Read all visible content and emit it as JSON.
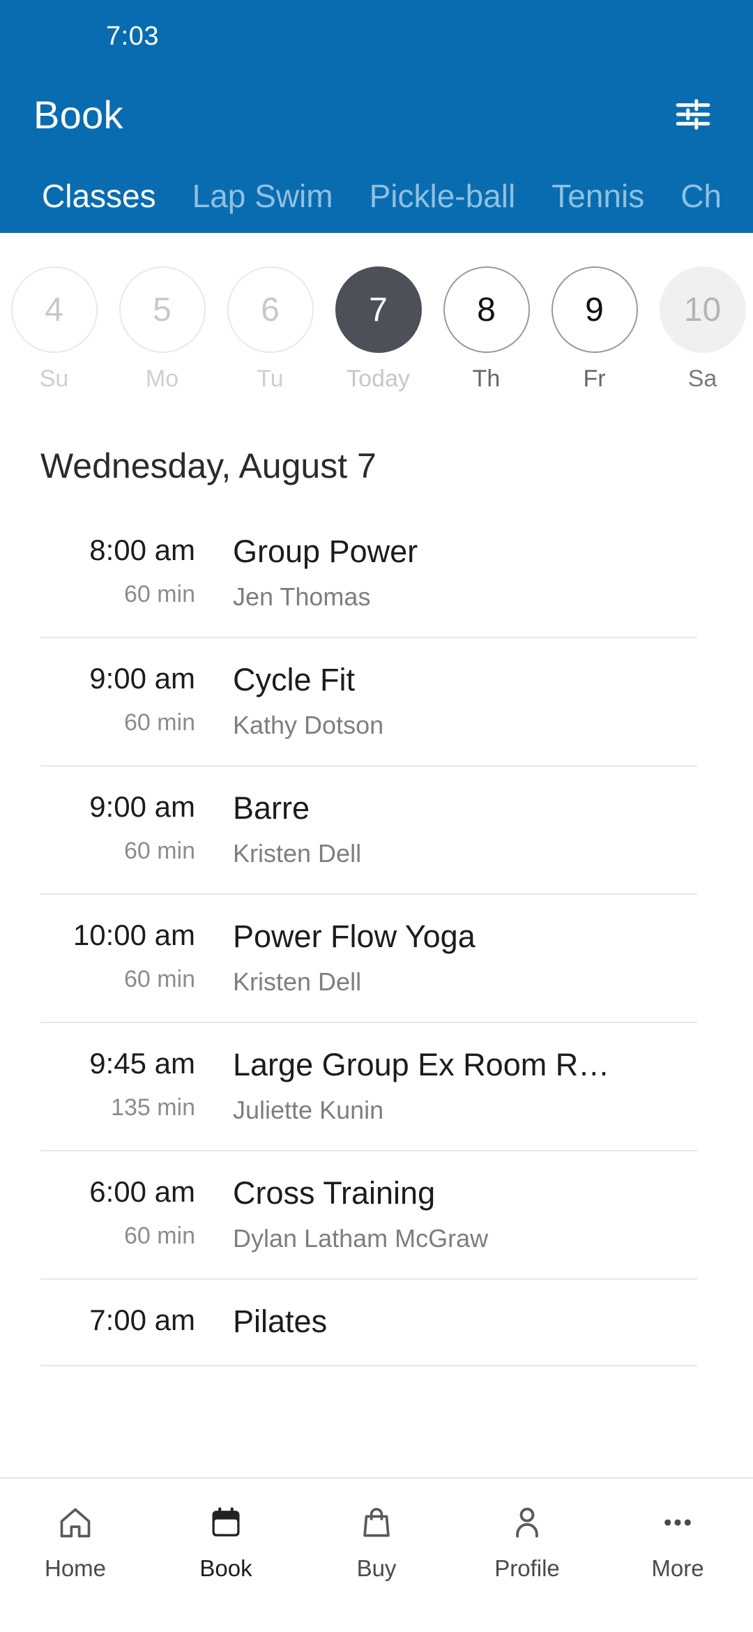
{
  "statusbar": {
    "time": "7:03"
  },
  "header": {
    "title": "Book",
    "filter_icon": "tune-sliders-icon",
    "background_color": "#0a6cb0",
    "tabs": [
      {
        "label": "Classes",
        "active": true
      },
      {
        "label": "Lap Swim",
        "active": false
      },
      {
        "label": "Pickle-ball",
        "active": false
      },
      {
        "label": "Tennis",
        "active": false
      },
      {
        "label": "Ch",
        "active": false
      }
    ]
  },
  "date_strip": [
    {
      "day": "4",
      "dow": "Su",
      "state": "disabled"
    },
    {
      "day": "5",
      "dow": "Mo",
      "state": "disabled"
    },
    {
      "day": "6",
      "dow": "Tu",
      "state": "disabled"
    },
    {
      "day": "7",
      "dow": "Today",
      "state": "selected"
    },
    {
      "day": "8",
      "dow": "Th",
      "state": "enabled"
    },
    {
      "day": "9",
      "dow": "Fr",
      "state": "enabled"
    },
    {
      "day": "10",
      "dow": "Sa",
      "state": "filled"
    }
  ],
  "day_heading": "Wednesday, August 7",
  "classes": [
    {
      "time": "8:00 am",
      "duration": "60 min",
      "name": "Group Power",
      "instructor": "Jen Thomas"
    },
    {
      "time": "9:00 am",
      "duration": "60 min",
      "name": "Cycle Fit",
      "instructor": "Kathy Dotson"
    },
    {
      "time": "9:00 am",
      "duration": "60 min",
      "name": "Barre",
      "instructor": "Kristen Dell"
    },
    {
      "time": "10:00 am",
      "duration": "60 min",
      "name": "Power Flow Yoga",
      "instructor": "Kristen Dell"
    },
    {
      "time": "9:45 am",
      "duration": "135 min",
      "name": "Large Group Ex Room R…",
      "instructor": "Juliette Kunin"
    },
    {
      "time": "6:00 am",
      "duration": "60 min",
      "name": "Cross Training",
      "instructor": "Dylan Latham McGraw"
    },
    {
      "time": "7:00 am",
      "duration": "",
      "name": "Pilates",
      "instructor": ""
    }
  ],
  "bottom_nav": [
    {
      "label": "Home",
      "icon": "home-icon",
      "active": false
    },
    {
      "label": "Book",
      "icon": "calendar-icon",
      "active": true
    },
    {
      "label": "Buy",
      "icon": "bag-icon",
      "active": false
    },
    {
      "label": "Profile",
      "icon": "person-icon",
      "active": false
    },
    {
      "label": "More",
      "icon": "ellipsis-icon",
      "active": false
    }
  ],
  "colors": {
    "brand_blue": "#0a6cb0",
    "selected_dark": "#4d5058",
    "tab_inactive": "#8fc0e2"
  }
}
